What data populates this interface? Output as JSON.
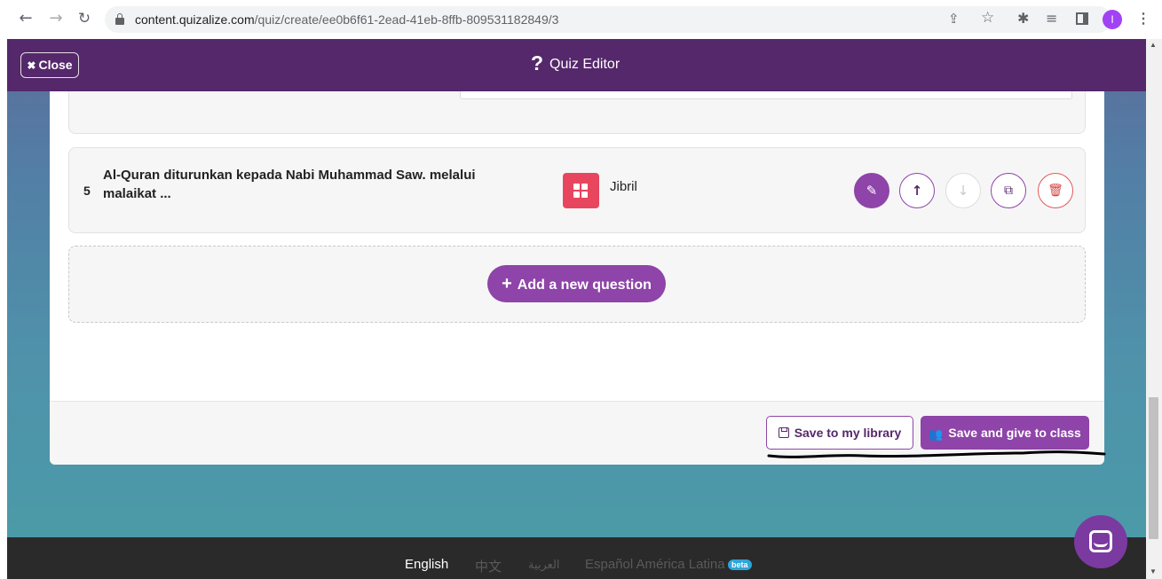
{
  "browser": {
    "url_host": "content.quizalize.com",
    "url_path": "/quiz/create/ee0b6f61-2ead-41eb-8ffb-809531182849/3",
    "profile_initial": "I"
  },
  "header": {
    "close_label": "Close",
    "title": "Quiz Editor"
  },
  "question": {
    "number": "5",
    "text": "Al-Quran diturunkan kepada Nabi Muhammad Saw. melalui malaikat ...",
    "answer": "Jibril"
  },
  "add_question_label": "Add a new question",
  "footer_actions": {
    "save_library_label": "Save to my library",
    "save_class_label": "Save and give to class"
  },
  "languages": {
    "english": "English",
    "chinese": "中文",
    "arabic": "العربية",
    "spanish": "Español América Latina",
    "beta": "beta"
  },
  "colors": {
    "brand_purple": "#54286a",
    "button_purple": "#8e44a8",
    "answer_red": "#e8465f",
    "delete_red": "#d43f3f"
  }
}
